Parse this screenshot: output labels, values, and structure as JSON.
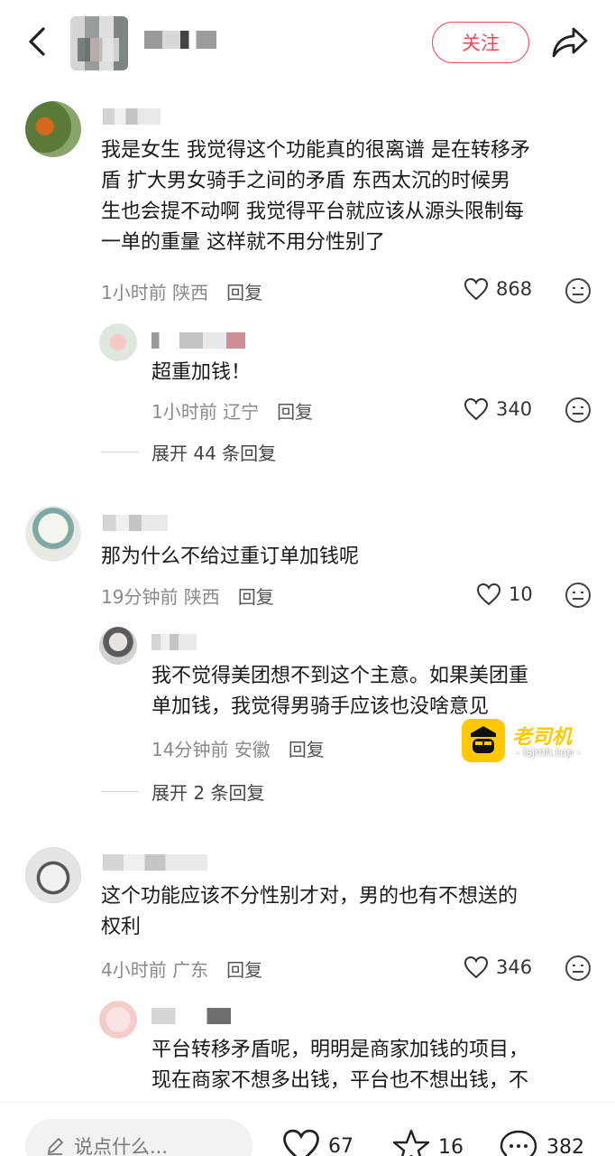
{
  "header": {
    "follow_label": "关注"
  },
  "comments": [
    {
      "text_lines": [
        "我是女生 我觉得这个功能真的很离谱 是在转移矛",
        "盾  扩大男女骑手之间的矛盾   东西太沉的时候男",
        "生也会提不动啊 我觉得平台就应该从源头限制每",
        "一单的重量 这样就不用分性别了"
      ],
      "time": "1小时前",
      "location": "陕西",
      "reply_label": "回复",
      "likes": "868",
      "sub": {
        "text": "超重加钱！",
        "time": "1小时前",
        "location": "辽宁",
        "reply_label": "回复",
        "likes": "340"
      },
      "expand_label": "展开 44 条回复"
    },
    {
      "text_lines": [
        "那为什么不给过重订单加钱呢"
      ],
      "time": "19分钟前",
      "location": "陕西",
      "reply_label": "回复",
      "likes": "10",
      "sub": {
        "text_lines": [
          "我不觉得美团想不到这个主意。如果美团重",
          "单加钱，我觉得男骑手应该也没啥意见"
        ],
        "time": "14分钟前",
        "location": "安徽",
        "reply_label": "回复"
      },
      "expand_label": "展开 2 条回复"
    },
    {
      "text_lines": [
        "这个功能应该不分性别才对，男的也有不想送的",
        "权利"
      ],
      "time": "4小时前",
      "location": "广东",
      "reply_label": "回复",
      "likes": "346",
      "sub": {
        "text_lines": [
          "平台转移矛盾呢，明明是商家加钱的项目，",
          "现在商家不想多出钱，平台也不想出钱，不"
        ]
      }
    }
  ],
  "watermark": {
    "brand": "老司机",
    "url": "- lsjmh.top -"
  },
  "bottom_bar": {
    "input_placeholder": "说点什么...",
    "like_count": "67",
    "star_count": "16",
    "comment_count": "382"
  },
  "colors": {
    "accent": "#f04a5a",
    "watermark": "#ffc800"
  },
  "icons": [
    "back-icon",
    "share-icon",
    "heart-icon",
    "emoji-icon",
    "pencil-icon",
    "star-icon",
    "comment-icon"
  ]
}
